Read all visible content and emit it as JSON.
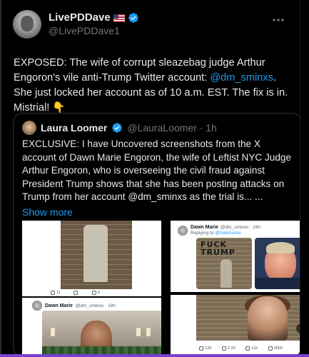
{
  "tweet": {
    "display_name": "LivePDDave",
    "handle": "@LivePDDave1",
    "text_before": "EXPOSED: The wife of corrupt sleazebag judge Arthur Engoron's vile anti-Trump Twitter account: ",
    "mention": "@dm_sminxs",
    "text_after": ". She just locked her account as of 10 a.m. EST. The fix is in. Mistrial! 👇"
  },
  "quote": {
    "display_name": "Laura Loomer",
    "handle_time": "@LauraLoomer · 1h",
    "text": "EXCLUSIVE: I have Uncovered screenshots from the X account of Dawn Marie Engoron, the wife of Leftist NYC Judge Arthur Engoron, who is overseeing the civil fraud  against President Trump shows that she has been posting attacks on Trump from her account @dm_sminxs as the trial is...  ...",
    "show_more": "Show more"
  },
  "media": {
    "shot2": {
      "name": "Dawn Marie",
      "handle_time": "@dm_sminxs · 19h",
      "replying_prefix": "Replying to ",
      "replying_to": "@SebGorka",
      "graffiti": "FUCK\nTRUMP"
    },
    "shot3": {
      "name": "Dawn Marie",
      "handle_time": "@dm_sminxs · 18h"
    },
    "shot4_stats": {
      "replies": "13K",
      "reposts": "2.3K",
      "likes": "11K",
      "views": "386K"
    },
    "shot1_stats": {
      "s1": "11",
      "s2": "",
      "s3": "8"
    }
  },
  "colors": {
    "background": "#000000",
    "text": "#e7e9ea",
    "secondary": "#71767b",
    "link": "#1d9bf0",
    "verified": "#1d9bf0",
    "border": "#2f3336",
    "bottom_bar": "#7b3fd0"
  }
}
